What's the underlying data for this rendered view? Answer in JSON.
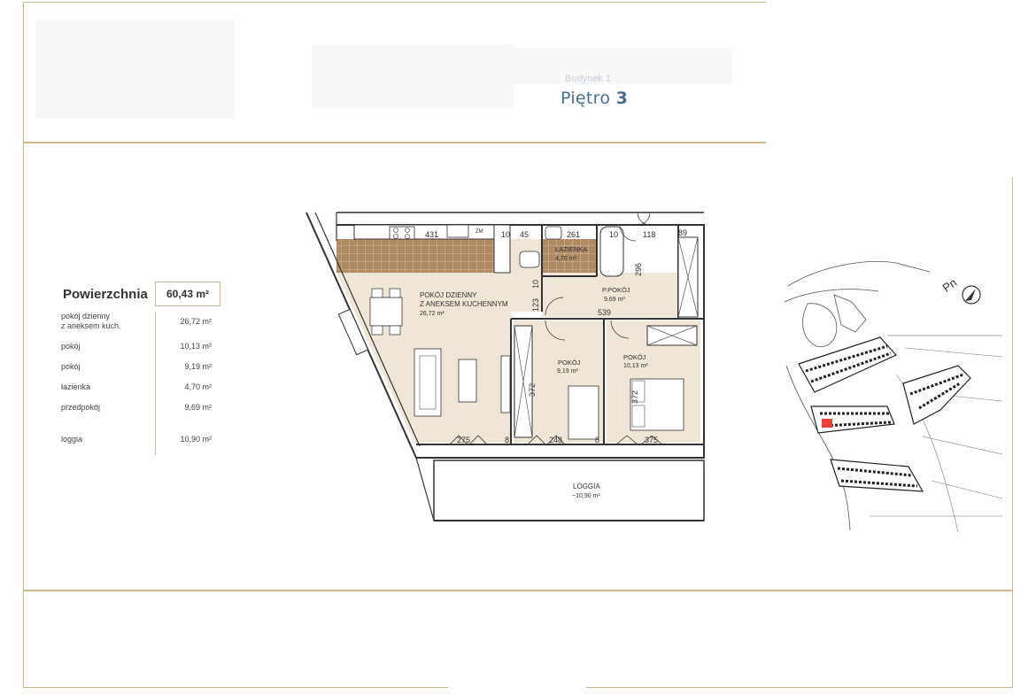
{
  "header": {
    "building_label": "Budynek 1",
    "floor_prefix": "Piętro",
    "floor_number": "3"
  },
  "summary": {
    "title": "Powierzchnia",
    "total": "60,43 m²",
    "rows": [
      {
        "label_line1": "pokój dzienny",
        "label_line2": "z aneksem kuch.",
        "value": "26,72 m²"
      },
      {
        "label_line1": "pokój",
        "label_line2": "",
        "value": "10,13 m²"
      },
      {
        "label_line1": "pokój",
        "label_line2": "",
        "value": "9,19 m²"
      },
      {
        "label_line1": "łazienka",
        "label_line2": "",
        "value": "4,70 m²"
      },
      {
        "label_line1": "przedpokój",
        "label_line2": "",
        "value": "9,69 m²"
      },
      {
        "label_line1": "loggia",
        "label_line2": "",
        "value": "10,90 m²"
      }
    ]
  },
  "floorplan": {
    "living": {
      "line1": "POKÓJ DZIENNY",
      "line2": "Z ANEKSEM KUCHENNYM",
      "area": "26,72 m²"
    },
    "bathroom": {
      "name": "ŁAZIENKA",
      "area": "4,70 m²"
    },
    "hall": {
      "name": "P.POKÓJ",
      "area": "9,69 m²"
    },
    "room1": {
      "name": "POKÓJ",
      "area": "9,19 m²"
    },
    "room2": {
      "name": "POKÓJ",
      "area": "10,13 m²"
    },
    "loggia": {
      "name": "LOGGIA",
      "area": "~10,90 m²"
    },
    "dimensions": {
      "d431": "431",
      "dzm": "ZM",
      "d10a": "10",
      "d45": "45",
      "d261": "261",
      "d10b": "10",
      "d118": "118",
      "d89": "89",
      "d123": "123",
      "d10c": "10",
      "d296": "296",
      "d539": "539",
      "d372": "372",
      "d275": "275",
      "d8": "8",
      "d248": "248",
      "d375": "375",
      "d8b": "8"
    }
  },
  "siteplan": {
    "north_label": "Pn",
    "apartment_marker_color": "#e8413a"
  }
}
